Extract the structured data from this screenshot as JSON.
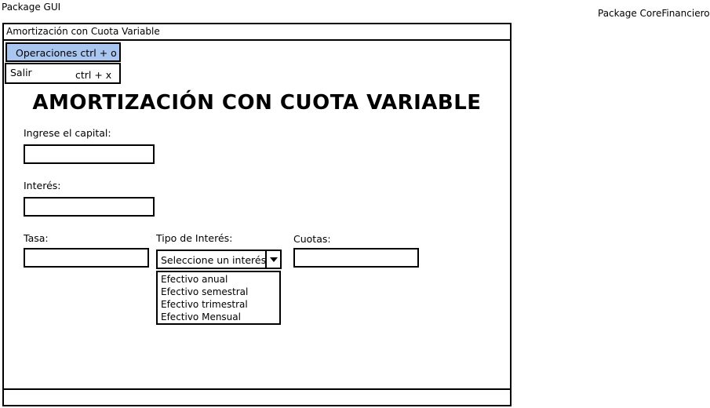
{
  "packages": {
    "gui": "Package GUI",
    "core": "Package CoreFinanciero"
  },
  "window": {
    "title": "Amortización con Cuota Variable"
  },
  "menu": {
    "items": [
      {
        "label": "Operaciones ctrl + o",
        "selected": true
      },
      {
        "label": "Salir",
        "shortcut": "ctrl + x"
      }
    ]
  },
  "form": {
    "heading": "AMORTIZACIÓN CON CUOTA VARIABLE",
    "capital_label": "Ingrese el capital:",
    "capital_value": "",
    "interes_label": "Interés:",
    "interes_value": "",
    "tasa_label": "Tasa:",
    "tasa_value": "",
    "tipo_label": "Tipo de Interés:",
    "tipo_selected": "Seleccione un interés",
    "tipo_options": [
      "Efectivo anual",
      "Efectivo semestral",
      "Efectivo trimestral",
      "Efectivo Mensual"
    ],
    "cuotas_label": "Cuotas:",
    "cuotas_value": ""
  },
  "colors": {
    "menu_highlight": "#a9c6f0",
    "border": "#000000"
  }
}
